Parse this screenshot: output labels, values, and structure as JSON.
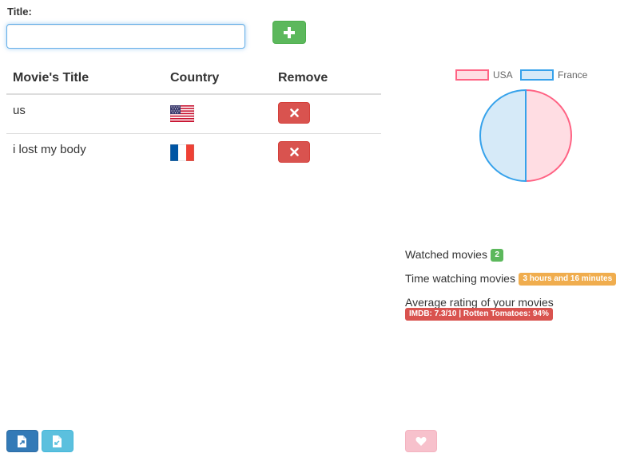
{
  "form": {
    "title_label": "Title:",
    "title_value": "",
    "title_placeholder": ""
  },
  "table": {
    "headers": [
      "Movie's Title",
      "Country",
      "Remove"
    ],
    "rows": [
      {
        "title": "us",
        "country": "USA",
        "flag": "usa-flag-icon"
      },
      {
        "title": "i lost my body",
        "country": "France",
        "flag": "france-flag-icon"
      }
    ]
  },
  "chart_data": {
    "type": "pie",
    "categories": [
      "USA",
      "France"
    ],
    "values": [
      1,
      1
    ],
    "legend": "top",
    "colors": {
      "USA": {
        "fill": "#ffdde3",
        "stroke": "#ff6384"
      },
      "France": {
        "fill": "#d6eaf8",
        "stroke": "#36a2eb"
      }
    }
  },
  "stats": {
    "watched_label": "Watched movies",
    "watched_count": "2",
    "time_label": "Time watching movies",
    "time_value": "3 hours and 16 minutes",
    "rating_label": "Average rating of your movies",
    "rating_value": "IMDB: 7.3/10 | Rotten Tomatoes: 94%"
  },
  "colors": {
    "success": "#5cb85c",
    "danger": "#d9534f",
    "warning": "#f0ad4e",
    "primary": "#337ab7",
    "info": "#5bc0de",
    "pink": "#f7c1cc"
  },
  "icons": {
    "add": "plus-icon",
    "remove": "close-icon",
    "export": "file-export-icon",
    "import": "file-import-icon",
    "like": "heart-icon"
  }
}
